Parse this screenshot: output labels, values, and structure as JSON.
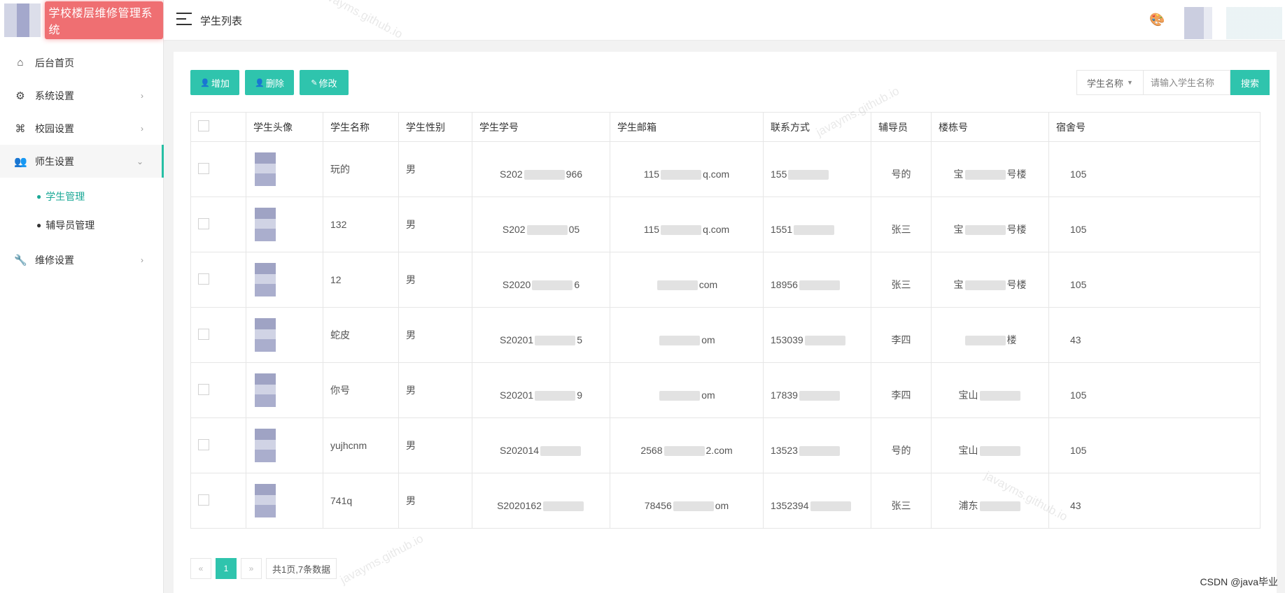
{
  "app": {
    "title": "学校楼层维修管理系统",
    "page_title": "学生列表"
  },
  "menu": [
    {
      "label": "后台首页",
      "icon": "home-icon",
      "glyph": "⌂",
      "has_arrow": false
    },
    {
      "label": "系统设置",
      "icon": "gear-icon",
      "glyph": "⚙",
      "has_arrow": true,
      "arrow": "›"
    },
    {
      "label": "校园设置",
      "icon": "bank-icon",
      "glyph": "⌘",
      "has_arrow": true,
      "arrow": "›"
    },
    {
      "label": "师生设置",
      "icon": "users-icon",
      "glyph": "👥",
      "has_arrow": true,
      "arrow": "⌄",
      "expanded": true
    },
    {
      "label": "维修设置",
      "icon": "wrench-icon",
      "glyph": "🔧",
      "has_arrow": true,
      "arrow": "›"
    }
  ],
  "submenu": [
    {
      "label": "学生管理",
      "icon": "user-icon",
      "selected": true
    },
    {
      "label": "辅导员管理",
      "icon": "user-gear-icon",
      "selected": false
    }
  ],
  "toolbar": {
    "add": "增加",
    "delete": "删除",
    "edit": "修改"
  },
  "search": {
    "field": "学生名称",
    "placeholder": "请输入学生名称",
    "button": "搜索"
  },
  "table": {
    "headers": [
      "学生头像",
      "学生名称",
      "学生性别",
      "学生学号",
      "学生邮箱",
      "联系方式",
      "辅导员",
      "楼栋号",
      "宿舍号"
    ],
    "rows": [
      {
        "name": "玩的",
        "gender": "男",
        "id_a": "S202",
        "id_b": "966",
        "email_a": "115",
        "email_b": "q.com",
        "phone": "155",
        "counselor": "号的",
        "bld_a": "宝",
        "bld_b": "号楼",
        "dorm": "105"
      },
      {
        "name": "132",
        "gender": "男",
        "id_a": "S202",
        "id_b": "05",
        "email_a": "115",
        "email_b": "q.com",
        "phone": "1551",
        "counselor": "张三",
        "bld_a": "宝",
        "bld_b": "号楼",
        "dorm": "105"
      },
      {
        "name": "12",
        "gender": "男",
        "id_a": "S2020",
        "id_b": "6",
        "email_a": "",
        "email_b": "com",
        "phone": "18956",
        "counselor": "张三",
        "bld_a": "宝",
        "bld_b": "号楼",
        "dorm": "105"
      },
      {
        "name": "蛇皮",
        "gender": "男",
        "id_a": "S20201",
        "id_b": "5",
        "email_a": "",
        "email_b": "om",
        "phone": "153039",
        "counselor": "李四",
        "bld_a": "",
        "bld_b": "楼",
        "dorm": "43"
      },
      {
        "name": "你号",
        "gender": "男",
        "id_a": "S20201",
        "id_b": "9",
        "email_a": "",
        "email_b": "om",
        "phone": "17839",
        "counselor": "李四",
        "bld_a": "宝山",
        "bld_b": "",
        "dorm": "105"
      },
      {
        "name": "yujhcnm",
        "gender": "男",
        "id_a": "S202014",
        "id_b": "",
        "email_a": "2568",
        "email_b": "2.com",
        "phone": "13523",
        "counselor": "号的",
        "bld_a": "宝山",
        "bld_b": "",
        "dorm": "105"
      },
      {
        "name": "741q",
        "gender": "男",
        "id_a": "S2020162",
        "id_b": "",
        "email_a": "78456",
        "email_b": "om",
        "phone": "1352394",
        "counselor": "张三",
        "bld_a": "浦东",
        "bld_b": "",
        "dorm": "43"
      }
    ]
  },
  "pagination": {
    "prev": "«",
    "current": "1",
    "next": "»",
    "info": "共1页,7条数据"
  },
  "watermark": "javayms.github.io",
  "footer": "CSDN @java毕业",
  "colors": {
    "accent": "#2fc4ad",
    "brand_bg": "#ef6f72"
  }
}
